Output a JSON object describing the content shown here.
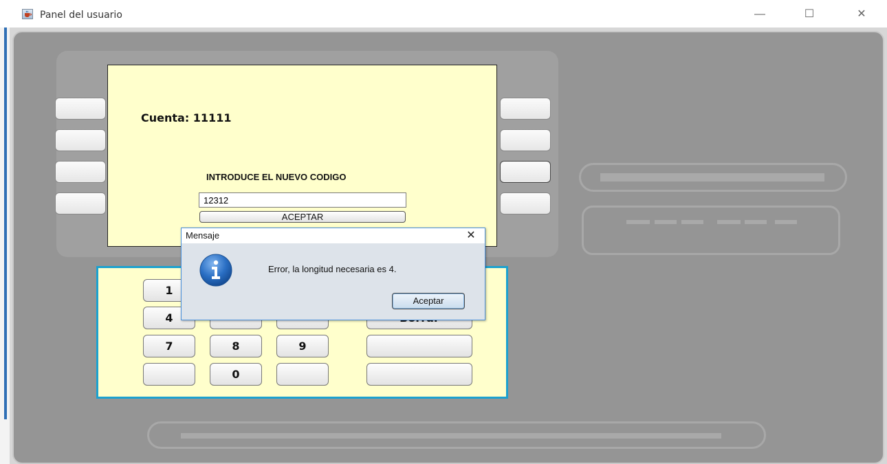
{
  "window": {
    "title": "Panel del usuario",
    "minimize_label": "—",
    "maximize_label": "☐",
    "close_label": "✕",
    "icon": "java-cup-icon"
  },
  "screen": {
    "account_text": "Cuenta: 11111",
    "prompt_label": "INTRODUCE EL NUEVO CODIGO",
    "code_value": "12312",
    "accept_label": "ACEPTAR"
  },
  "keypad": {
    "keys": [
      "1",
      "4",
      "7",
      "8",
      "9",
      "0"
    ],
    "function_key_label": "Borrar"
  },
  "dialog": {
    "title": "Mensaje",
    "close_label": "✕",
    "message": "Error, la longitud necesaria es 4.",
    "button_label": "Aceptar",
    "icon": "info-icon"
  },
  "colors": {
    "atm_body": "#959595",
    "screen_bg": "#ffffcc",
    "keypad_border": "#1ba1d0",
    "dialog_bg": "#dde3ea",
    "info_icon_blue": "#2a6fc4"
  }
}
